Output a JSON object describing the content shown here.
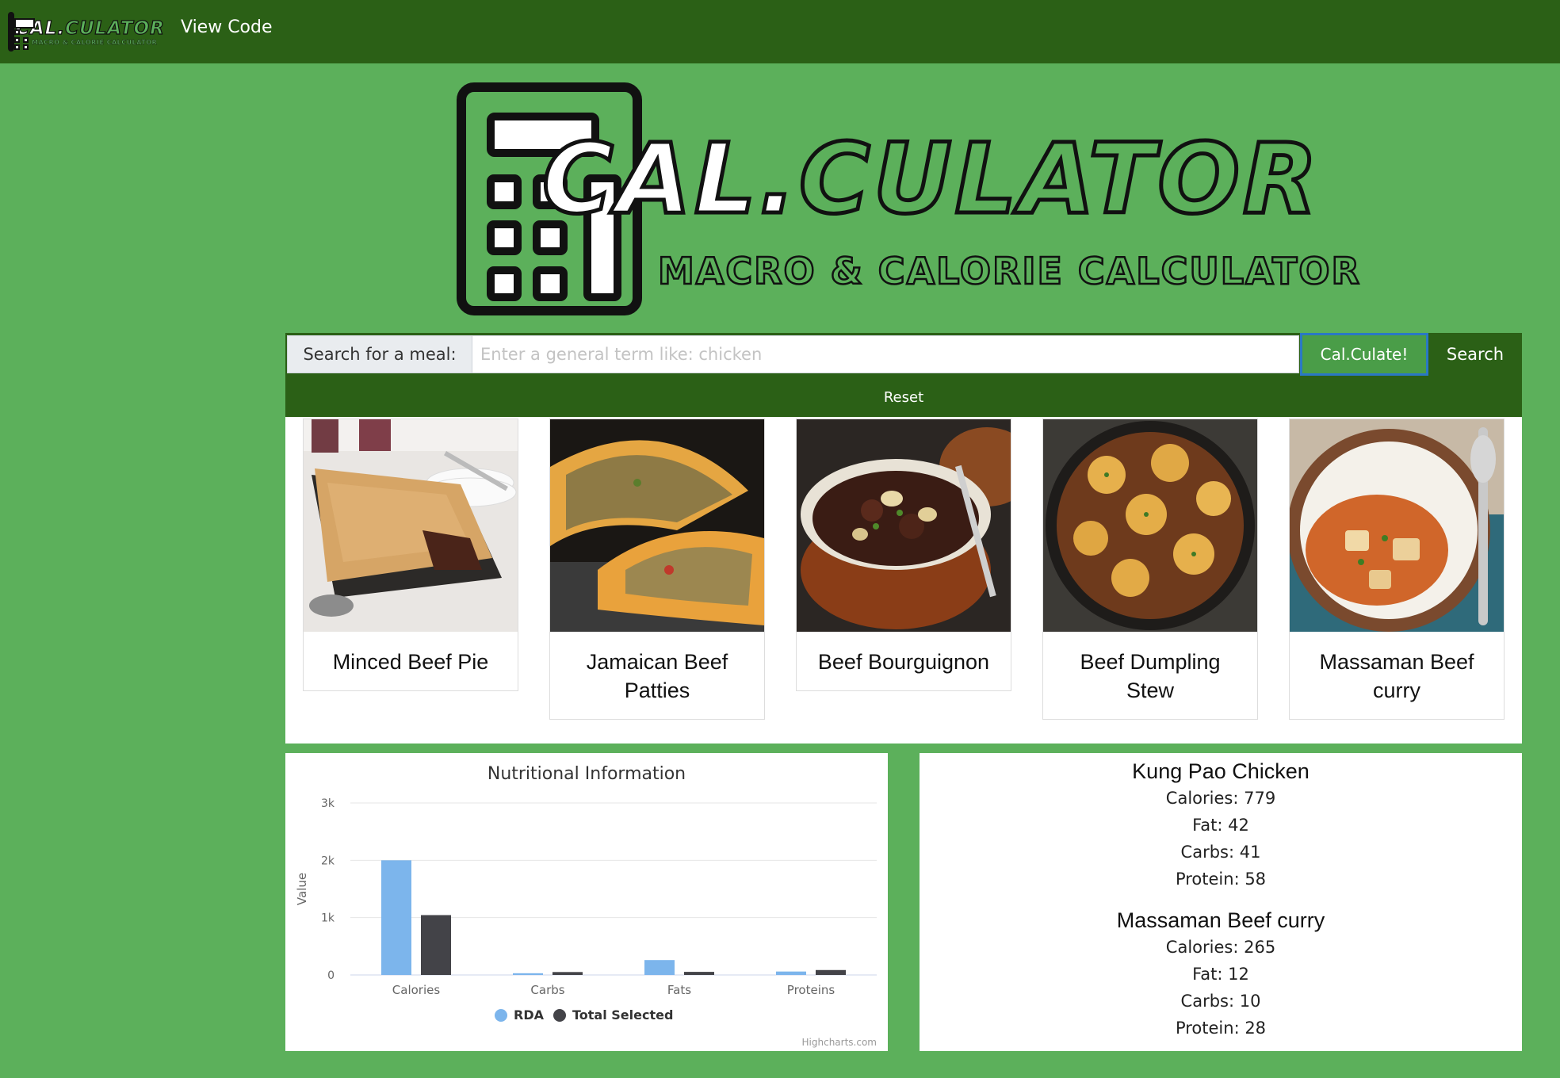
{
  "nav": {
    "logo_title_a": "CAL.",
    "logo_title_b": "CULATOR",
    "logo_subtitle": "MACRO & CALORIE CALCULATOR",
    "view_code": "View Code"
  },
  "hero": {
    "title_a": "CAL.",
    "title_b": "CULATOR",
    "subtitle": "MACRO & CALORIE CALCULATOR"
  },
  "search": {
    "label": "Search for a meal:",
    "placeholder": "Enter a general term like: chicken",
    "value": "",
    "calculate_label": "Cal.Culate!",
    "search_label": "Search",
    "reset_label": "Reset"
  },
  "meals": [
    {
      "name": "Minced Beef Pie"
    },
    {
      "name": "Jamaican Beef Patties"
    },
    {
      "name": "Beef Bourguignon"
    },
    {
      "name": "Beef Dumpling Stew"
    },
    {
      "name": "Massaman Beef curry"
    }
  ],
  "chart_data": {
    "type": "bar",
    "title": "Nutritional Information",
    "xlabel": "",
    "ylabel": "Value",
    "categories": [
      "Calories",
      "Carbs",
      "Fats",
      "Proteins"
    ],
    "series": [
      {
        "name": "RDA",
        "color": "#7cb5ec",
        "values": [
          2000,
          30,
          260,
          60
        ]
      },
      {
        "name": "Total Selected",
        "color": "#434348",
        "values": [
          1044,
          51,
          54,
          86
        ]
      }
    ],
    "ylim": [
      0,
      3000
    ],
    "yticks": [
      0,
      1000,
      2000,
      3000
    ],
    "ytick_labels": [
      "0",
      "1k",
      "2k",
      "3k"
    ],
    "grid": true,
    "legend": "bottom-center",
    "credit": "Highcharts.com"
  },
  "selected": [
    {
      "name": "Kung Pao Chicken",
      "lines": [
        "Calories: 779",
        "Fat: 42",
        "Carbs: 41",
        "Protein: 58"
      ]
    },
    {
      "name": "Massaman Beef curry",
      "lines": [
        "Calories: 265",
        "Fat: 12",
        "Carbs: 10",
        "Protein: 28"
      ]
    }
  ],
  "colors": {
    "page_bg": "#5cb05b",
    "navbar": "#2b6016",
    "button_green": "#4a9d48",
    "focus_ring": "#2a78c4"
  }
}
